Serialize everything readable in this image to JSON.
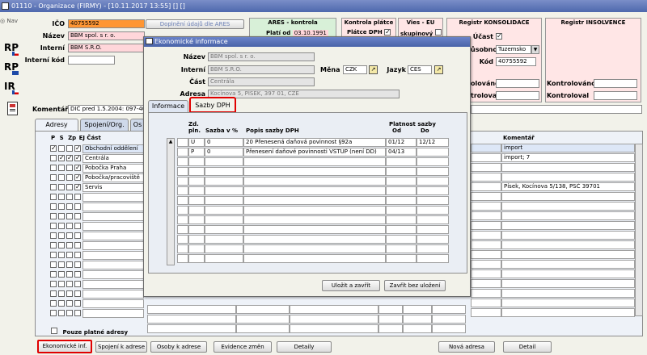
{
  "window": {
    "title": "01110 - Organizace (FIRMY) - [10.11.2017 13:55] [] []"
  },
  "sidebar": {
    "nav": "Nav",
    "icons": [
      {
        "label": "RP"
      },
      {
        "label": "RP"
      },
      {
        "label": "IR"
      },
      {
        "label": ""
      }
    ]
  },
  "header": {
    "ico_label": "IČO",
    "ico_value": "40755592",
    "nazev_label": "Název",
    "nazev_value": "BBM spol. s r. o.",
    "interni_label": "Interní",
    "interni_value": "BBM S.R.O.",
    "interni_kod_label": "Interní kód",
    "ares_button": "Doplnění údajů dle ARES",
    "komentar_label": "Komentář",
    "komentar_value": "DIČ pred 1.5.2004: 097-407"
  },
  "ares_panel": {
    "title": "ARES - kontrola",
    "plati_od_label": "Platí od",
    "plati_od_value": "03.10.1991"
  },
  "platce_panel": {
    "title": "Kontrola plátce",
    "platce_label": "Plátce DPH"
  },
  "vies_panel": {
    "title": "Vies - EU",
    "skupinovy_label": "skupinový"
  },
  "konsolidace_panel": {
    "title": "Registr KONSOLIDACE",
    "ucast_label": "Účast",
    "pusobnost_label": "ůsobnost",
    "pusobnost_value": "Tuzemsko",
    "kod_label": "Kód",
    "kod_value": "40755592",
    "kontrolovano_label": "olováno",
    "kontroloval_label": "troloval"
  },
  "insolvence_panel": {
    "title": "Registr INSOLVENCE",
    "kontrolovano_label": "Kontrolováno",
    "kontroloval_label": "Kontroloval"
  },
  "tabs": [
    {
      "label": "Adresy"
    },
    {
      "label": "Spojení/Org."
    },
    {
      "label": "Os"
    }
  ],
  "address_table": {
    "headers": [
      "P",
      "S",
      "Zp",
      "EJ",
      "Část"
    ],
    "rows": [
      {
        "cast": "Obchodní oddělení",
        "ej": true,
        "p": true
      },
      {
        "cast": "Centrála",
        "ej": true,
        "s": true,
        "zp": true
      },
      {
        "cast": "Pobočka Praha",
        "ej": true
      },
      {
        "cast": "Pobočka/pracoviště",
        "ej": true
      },
      {
        "cast": "Servis",
        "ej": true
      }
    ],
    "only_valid_label": "Pouze platné adresy"
  },
  "comment_column": {
    "header": "Komentář",
    "values": [
      "import",
      "import; 7",
      "",
      "",
      "Písek, Kocínova 5/138, PSČ 39701"
    ]
  },
  "bottom_buttons": {
    "ekonomicke": "Ekonomické inf.",
    "spojeni": "Spojení k adrese",
    "osoby": "Osoby k adrese",
    "evidence": "Evidence změn",
    "detaily": "Detaily",
    "nova_adresa": "Nová adresa",
    "detail": "Detail"
  },
  "modal": {
    "title": "Ekonomické informace",
    "nazev_label": "Název",
    "nazev_value": "BBM spol. s r. o.",
    "interni_label": "Interní",
    "interni_value": "BBM S.R.O.",
    "mena_label": "Měna",
    "mena_value": "CZK",
    "jazyk_label": "Jazyk",
    "jazyk_value": "ČES",
    "cast_label": "Část",
    "cast_value": "Centrála",
    "adresa_label": "Adresa",
    "adresa_value": "Kocínova 5, PÍSEK, 397 01, CZE",
    "tabs": [
      {
        "label": "Informace"
      },
      {
        "label": "Sazby DPH"
      }
    ],
    "table": {
      "headers": {
        "zd": "Zd. pln.",
        "sazba": "Sazba v %",
        "popis": "Popis sazby DPH",
        "platnost": "Platnost sazby",
        "od": "Od",
        "do": "Do"
      },
      "rows": [
        {
          "zd": "U",
          "sazba": "0",
          "popis": "20 Přenesená daňová povinnost §92a",
          "od": "01/12",
          "do": "12/12"
        },
        {
          "zd": "P",
          "sazba": "0",
          "popis": "Přenesení daňové povinnosti VSTUP (není DD)",
          "od": "04/13",
          "do": ""
        }
      ]
    },
    "save_button": "Uložit a zavřít",
    "close_button": "Zavřít bez uložení"
  }
}
